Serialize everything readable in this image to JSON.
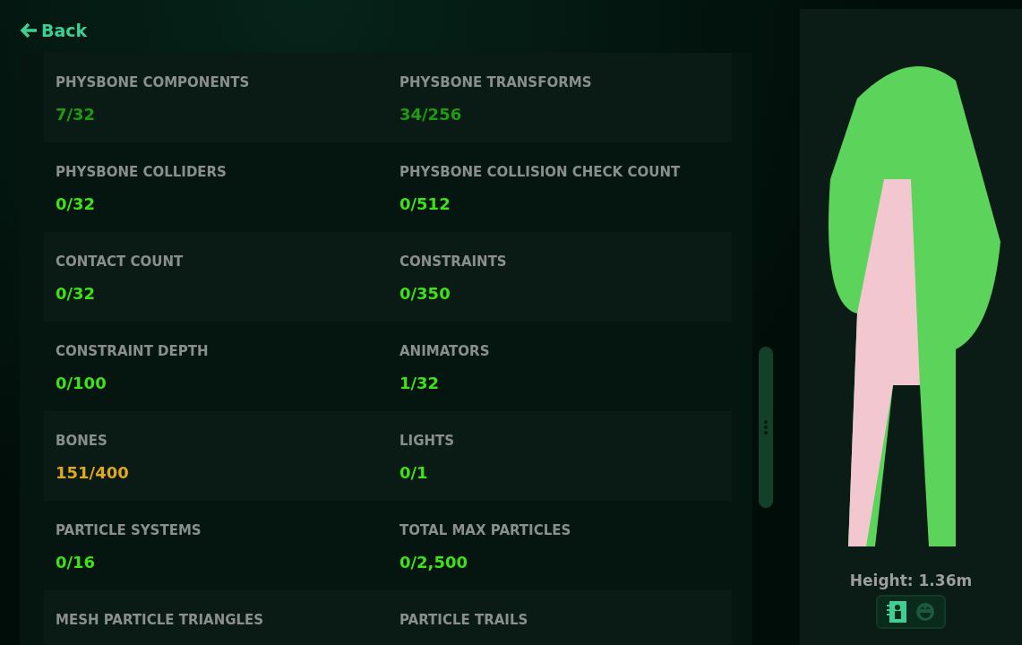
{
  "back_link": {
    "label": "Back"
  },
  "stats": [
    {
      "label": "PHYSBONE COMPONENTS",
      "value": "7/32",
      "color": "#1f9a12"
    },
    {
      "label": "PHYSBONE TRANSFORMS",
      "value": "34/256",
      "color": "#1f9a12"
    },
    {
      "label": "PHYSBONE COLLIDERS",
      "value": "0/32",
      "color": "#3fe21a"
    },
    {
      "label": "PHYSBONE COLLISION CHECK COUNT",
      "value": "0/512",
      "color": "#3fe21a"
    },
    {
      "label": "CONTACT COUNT",
      "value": "0/32",
      "color": "#3fe21a"
    },
    {
      "label": "CONSTRAINTS",
      "value": "0/350",
      "color": "#3fe21a"
    },
    {
      "label": "CONSTRAINT DEPTH",
      "value": "0/100",
      "color": "#3fe21a"
    },
    {
      "label": "ANIMATORS",
      "value": "1/32",
      "color": "#3fe21a"
    },
    {
      "label": "BONES",
      "value": "151/400",
      "color": "#e0a81e"
    },
    {
      "label": "LIGHTS",
      "value": "0/1",
      "color": "#3fe21a"
    },
    {
      "label": "PARTICLE SYSTEMS",
      "value": "0/16",
      "color": "#3fe21a"
    },
    {
      "label": "TOTAL MAX PARTICLES",
      "value": "0/2,500",
      "color": "#3fe21a"
    },
    {
      "label": "MESH PARTICLE TRIANGLES"
    },
    {
      "label": "PARTICLE TRAILS"
    }
  ],
  "preview": {
    "height_label": "Height: 1.36m",
    "view_buttons": [
      {
        "kind": "info",
        "selected": true
      },
      {
        "kind": "face",
        "selected": false
      }
    ]
  }
}
